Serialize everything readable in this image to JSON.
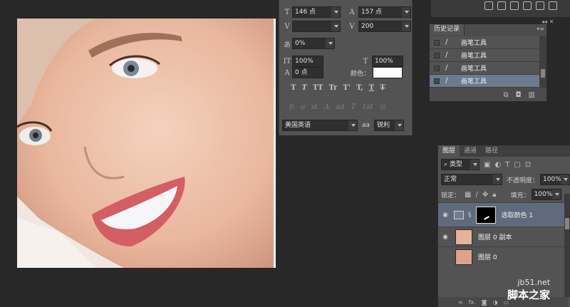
{
  "character": {
    "font_size": "146 点",
    "leading": "157 点",
    "kerning": "",
    "tracking": "200",
    "tsume": "0%",
    "vert_scale": "100%",
    "horiz_scale": "100%",
    "baseline": "0 点",
    "color_label": "颜色：",
    "language": "美国英语",
    "aa_label": "aa",
    "aa_method": "锐利",
    "type_buttons": [
      "T",
      "T",
      "TT",
      "Tr",
      "T'",
      "T,",
      "T",
      "T"
    ],
    "opentype_buttons": [
      "fi",
      "ơ",
      "st",
      "A",
      "ad",
      "T",
      "1st",
      "½"
    ]
  },
  "history": {
    "tab": "历史记录",
    "items": [
      {
        "label": "画笔工具"
      },
      {
        "label": "画笔工具"
      },
      {
        "label": "画笔工具"
      },
      {
        "label": "画笔工具"
      }
    ]
  },
  "layers": {
    "tabs": [
      "图层",
      "通道",
      "路径"
    ],
    "filter_kind": "类型",
    "blend_mode": "正常",
    "opacity_label": "不透明度：",
    "opacity": "100%",
    "lock_label": "锁定：",
    "fill_label": "填充：",
    "fill": "100%",
    "items": [
      {
        "name": "选取颜色 1"
      },
      {
        "name": "图层 0 副本"
      },
      {
        "name": "图层 0"
      }
    ],
    "footer_fx": "fx."
  },
  "watermark": {
    "site": "jb51.net",
    "name": "脚本之家"
  }
}
